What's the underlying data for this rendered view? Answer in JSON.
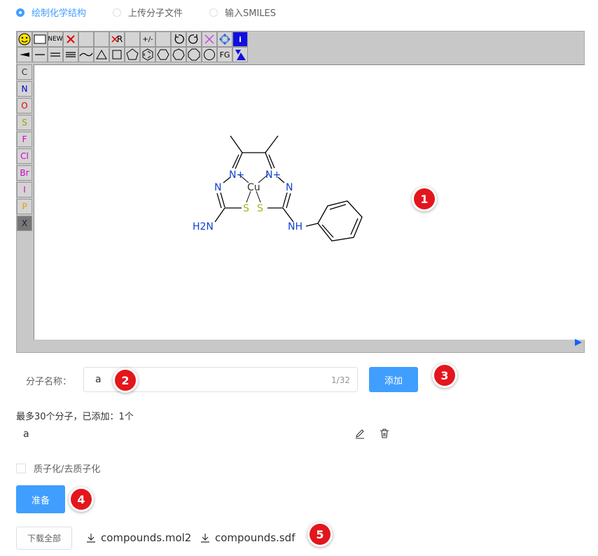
{
  "mode_tabs": [
    {
      "label": "绘制化学结构",
      "active": true
    },
    {
      "label": "上传分子文件",
      "active": false
    },
    {
      "label": "输入SMILES",
      "active": false
    }
  ],
  "toolbar": {
    "new_label": "NEW",
    "delete_r_label": "R",
    "charge_label": "+/-",
    "fg_label": "FG",
    "info_label": "i"
  },
  "elements": [
    {
      "symbol": "C",
      "color": "#303030"
    },
    {
      "symbol": "N",
      "color": "#0000cc"
    },
    {
      "symbol": "O",
      "color": "#e00000"
    },
    {
      "symbol": "S",
      "color": "#a0a000"
    },
    {
      "symbol": "F",
      "color": "#d000d0"
    },
    {
      "symbol": "Cl",
      "color": "#d000d0"
    },
    {
      "symbol": "Br",
      "color": "#d000d0"
    },
    {
      "symbol": "I",
      "color": "#d000d0"
    },
    {
      "symbol": "P",
      "color": "#e0a000"
    },
    {
      "symbol": "X",
      "color": "#303030"
    }
  ],
  "molecule": {
    "atoms": {
      "n_plus_left": "N+",
      "n_plus_right": "N+",
      "cu": "Cu",
      "n_left": "N",
      "n_right": "N",
      "s_left": "S",
      "s_right": "S",
      "h2n": "H2N",
      "nh": "NH"
    },
    "colors": {
      "nitrogen": "#1040d0",
      "sulfur": "#b0b020",
      "bond": "#000000",
      "metal": "#303030"
    }
  },
  "badges": [
    "1",
    "2",
    "3",
    "4",
    "5"
  ],
  "name_field": {
    "label": "分子名称：",
    "value": "a",
    "counter": "1/32"
  },
  "add_button": "添加",
  "summary": "最多30个分子，已添加：1个",
  "molecules": [
    {
      "name": "a"
    }
  ],
  "protonation_label": "质子化/去质子化",
  "prepare_button": "准备",
  "download_all_button": "下载全部",
  "downloads": [
    "compounds.mol2",
    "compounds.sdf"
  ],
  "accent_color": "#409eff"
}
